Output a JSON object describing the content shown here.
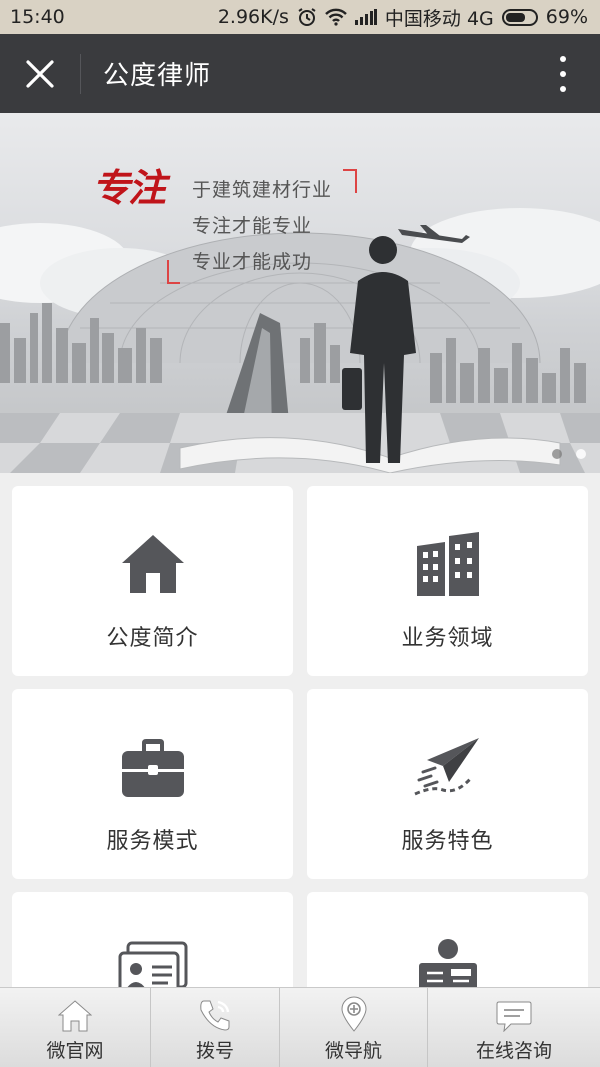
{
  "status_bar": {
    "time": "15:40",
    "speed": "2.96K/s",
    "carrier": "中国移动 4G",
    "battery": "69%",
    "battery_level": 0.69
  },
  "title_bar": {
    "title": "公度律师"
  },
  "banner": {
    "slogan_big": "专注",
    "lines": [
      "于建筑建材行业",
      "专注才能专业",
      "专业才能成功"
    ],
    "slides_count": 2,
    "active_slide": 1
  },
  "menu": [
    {
      "label": "公度简介",
      "icon": "home-icon"
    },
    {
      "label": "业务领域",
      "icon": "buildings-icon"
    },
    {
      "label": "服务模式",
      "icon": "briefcase-icon"
    },
    {
      "label": "服务特色",
      "icon": "paper-plane-icon"
    },
    {
      "label": "",
      "icon": "id-card-icon"
    },
    {
      "label": "",
      "icon": "news-reader-icon"
    }
  ],
  "bottom_nav": [
    {
      "label": "微官网",
      "icon": "home-icon"
    },
    {
      "label": "拨号",
      "icon": "phone-icon"
    },
    {
      "label": "微导航",
      "icon": "map-pin-icon"
    },
    {
      "label": "在线咨询",
      "icon": "chat-icon"
    }
  ],
  "colors": {
    "title_bar": "#3a3b3e",
    "icon_gray": "#55565a",
    "slogan_red": "#c0141a"
  }
}
